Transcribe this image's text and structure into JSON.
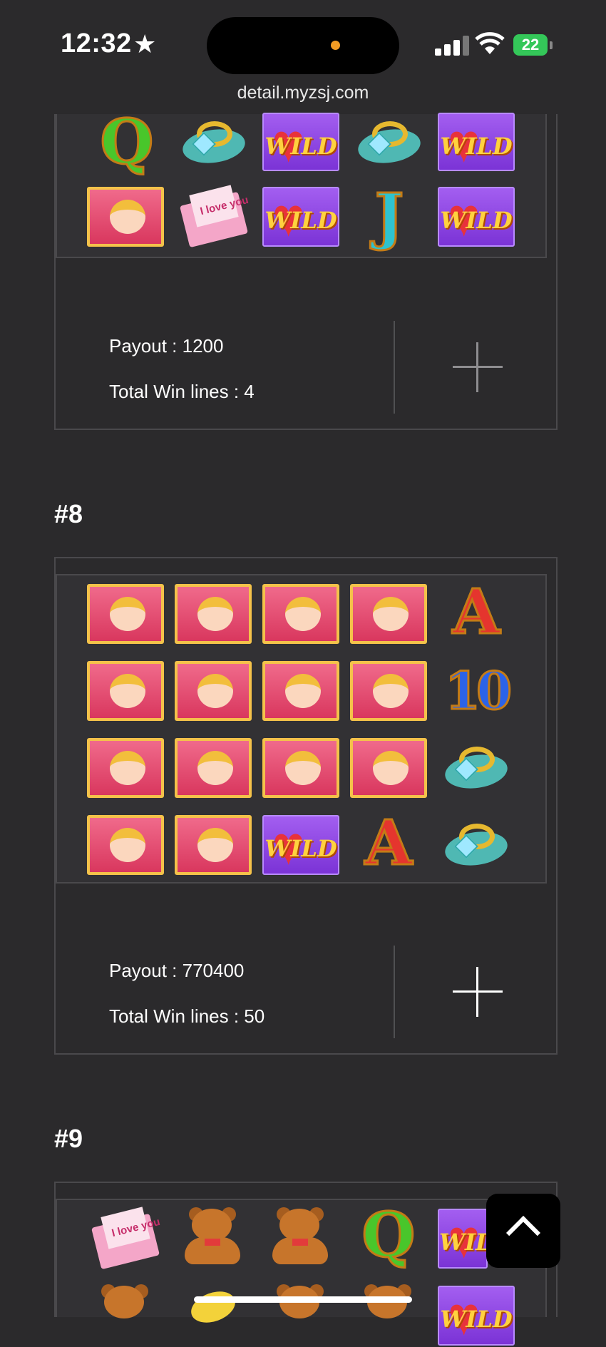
{
  "status_bar": {
    "time": "12:32",
    "battery": "22",
    "url": "detail.myzsj.com"
  },
  "icons": {
    "focus": "star-icon",
    "signal": "cellular-signal-icon",
    "wifi": "wifi-icon",
    "battery": "battery-charging-icon",
    "expand": "plus-icon",
    "scroll_top": "chevron-up-icon"
  },
  "colors": {
    "background": "#2b2a2c",
    "border": "#4a494c",
    "wild_purple": "#8a42e0",
    "cupid_pink": "#e4486e"
  },
  "results": [
    {
      "number": "",
      "visible_rows": [
        [
          "Q",
          "ring",
          "WILD",
          "ring",
          "WILD"
        ],
        [
          "cupid",
          "love-letter",
          "WILD",
          "J",
          "WILD"
        ]
      ],
      "wild_text": "WILD",
      "payout_label": "Payout : 1200",
      "win_lines_label": "Total Win lines : 4"
    },
    {
      "number": "#8",
      "visible_rows": [
        [
          "cupid",
          "cupid",
          "cupid",
          "cupid",
          "A"
        ],
        [
          "cupid",
          "cupid",
          "cupid",
          "cupid",
          "10"
        ],
        [
          "cupid",
          "cupid",
          "cupid",
          "cupid",
          "ring"
        ],
        [
          "cupid",
          "cupid",
          "WILD",
          "A",
          "ring"
        ]
      ],
      "wild_text": "WILD",
      "letters": {
        "a": "A",
        "ten": "10"
      },
      "payout_label": "Payout : 770400",
      "win_lines_label": "Total Win lines : 50"
    },
    {
      "number": "#9",
      "visible_rows": [
        [
          "love-letter",
          "bear",
          "bear",
          "Q",
          "WILD"
        ],
        [
          "bear",
          "lemon",
          "bear",
          "bear",
          "WILD"
        ]
      ],
      "wild_text": "WILD"
    }
  ],
  "symbol_text": {
    "q": "Q",
    "j": "J",
    "love_letter": "I love you"
  }
}
